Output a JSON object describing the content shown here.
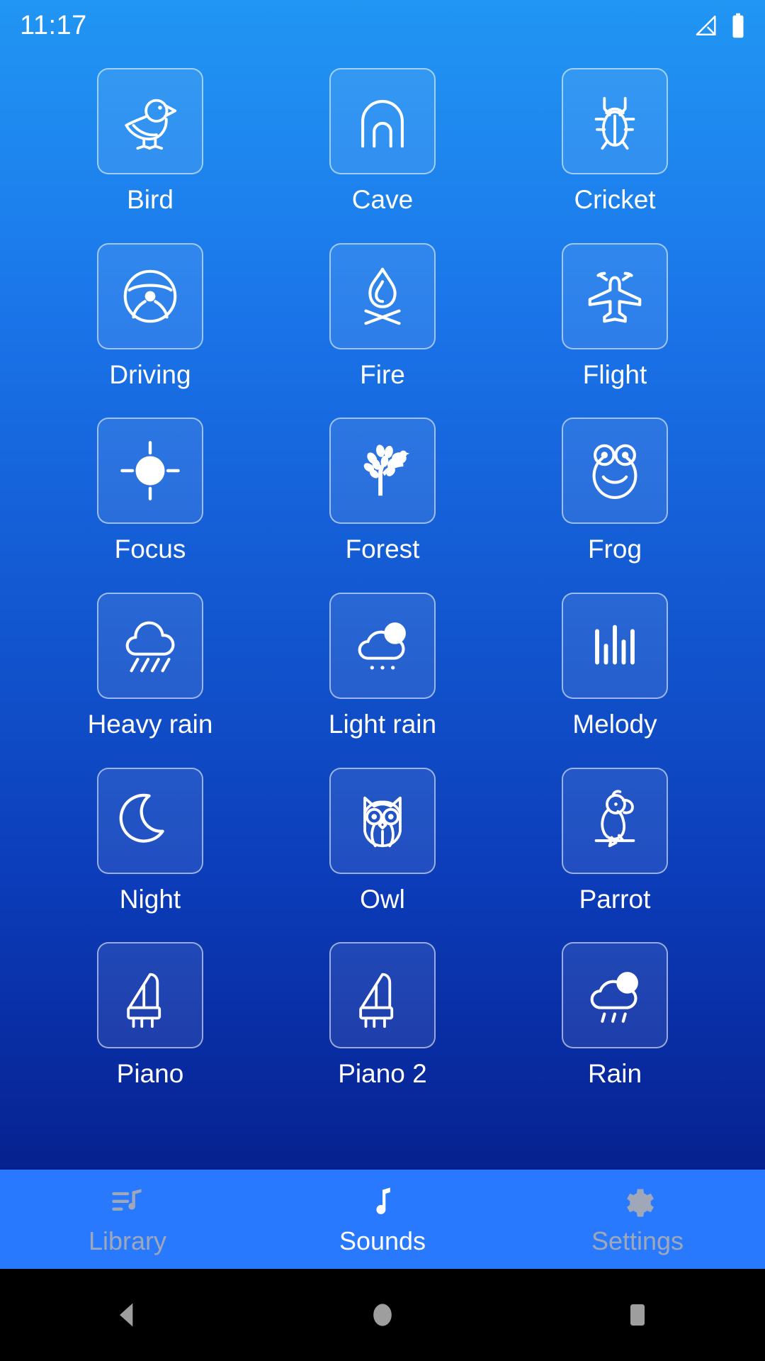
{
  "status_bar": {
    "time": "11:17",
    "signal_icon": "signal-no-service-icon",
    "battery_icon": "battery-full-icon"
  },
  "screen": {
    "active_tab": "Sounds",
    "background_gradient_top": "#2196f3",
    "background_gradient_bottom": "#03106e",
    "accent_color": "#2979ff",
    "tile_label_color": "#ffffff",
    "inactive_tab_color": "#9fa8b8"
  },
  "sounds_grid": {
    "columns": 3,
    "items": [
      {
        "label": "Bird",
        "icon": "bird-icon"
      },
      {
        "label": "Cave",
        "icon": "cave-icon"
      },
      {
        "label": "Cricket",
        "icon": "cricket-icon"
      },
      {
        "label": "Driving",
        "icon": "steering-wheel-icon"
      },
      {
        "label": "Fire",
        "icon": "campfire-icon"
      },
      {
        "label": "Flight",
        "icon": "airplane-icon"
      },
      {
        "label": "Focus",
        "icon": "crosshair-icon"
      },
      {
        "label": "Forest",
        "icon": "tree-icon"
      },
      {
        "label": "Frog",
        "icon": "frog-icon"
      },
      {
        "label": "Heavy rain",
        "icon": "heavy-rain-cloud-icon"
      },
      {
        "label": "Light rain",
        "icon": "light-rain-cloud-icon"
      },
      {
        "label": "Melody",
        "icon": "equalizer-bars-icon"
      },
      {
        "label": "Night",
        "icon": "crescent-moon-icon"
      },
      {
        "label": "Owl",
        "icon": "owl-icon"
      },
      {
        "label": "Parrot",
        "icon": "parrot-icon"
      },
      {
        "label": "Piano",
        "icon": "piano-icon"
      },
      {
        "label": "Piano 2",
        "icon": "piano-icon"
      },
      {
        "label": "Rain",
        "icon": "rain-cloud-icon"
      }
    ]
  },
  "bottom_nav": {
    "tabs": [
      {
        "label": "Library",
        "icon": "playlist-music-icon",
        "active": false
      },
      {
        "label": "Sounds",
        "icon": "music-note-icon",
        "active": true
      },
      {
        "label": "Settings",
        "icon": "gear-icon",
        "active": false
      }
    ]
  },
  "system_nav": {
    "back": "back-triangle-icon",
    "home": "home-circle-icon",
    "recents": "recents-square-icon"
  }
}
